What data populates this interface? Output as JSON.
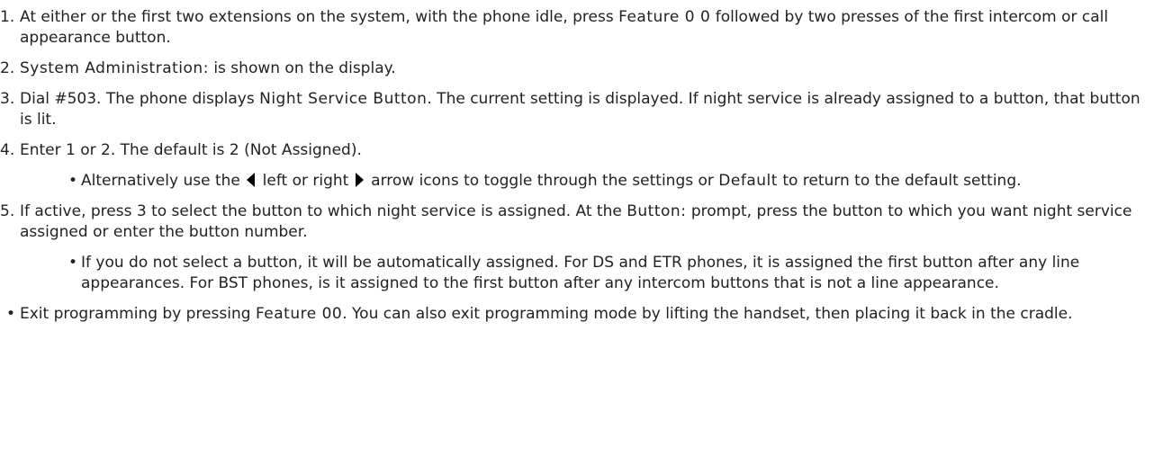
{
  "steps": [
    {
      "num": "1.",
      "text_a": "At either or the first two extensions on the system, with the phone idle, press ",
      "code_a": "Feature 0 0",
      "text_b": " followed by two presses of the first intercom or call appearance button."
    },
    {
      "num": "2.",
      "code_a": "System Administration:",
      "text_a": " is shown on the display."
    },
    {
      "num": "3.",
      "text_a": "Dial #503. The phone displays ",
      "code_a": "Night Service Button",
      "text_b": ". The current setting is displayed. If night service is already assigned to a button, that button is lit."
    },
    {
      "num": "4.",
      "text_a": "Enter 1 or 2. The default is 2 (Not Assigned).",
      "sub": {
        "bullet": "•",
        "text_a": "Alternatively use the ",
        "left_icon": "left-arrow-icon",
        "text_b": " left or right ",
        "right_icon": "right-arrow-icon",
        "text_c": " arrow icons to toggle through the settings or ",
        "code_a": "Default",
        "text_d": " to return to the default setting."
      }
    },
    {
      "num": "5.",
      "text_a": "If active, press 3 to select the button to which night service is assigned. At the ",
      "code_a": "Button:",
      "text_b": " prompt, press the button to which you want night service assigned or enter the button number.",
      "sub": {
        "bullet": "•",
        "text_a": "If you do not select a button, it will be automatically assigned. For DS and ETR phones, it is assigned the first button after any line appearances. For BST phones, is it assigned to the first button after any intercom buttons that is not a line appearance."
      }
    }
  ],
  "final": {
    "bullet": "•",
    "text_a": "Exit programming by pressing ",
    "code_a": "Feature 00",
    "text_b": ". You can also exit programming mode by lifting the handset, then placing it back in the cradle."
  }
}
